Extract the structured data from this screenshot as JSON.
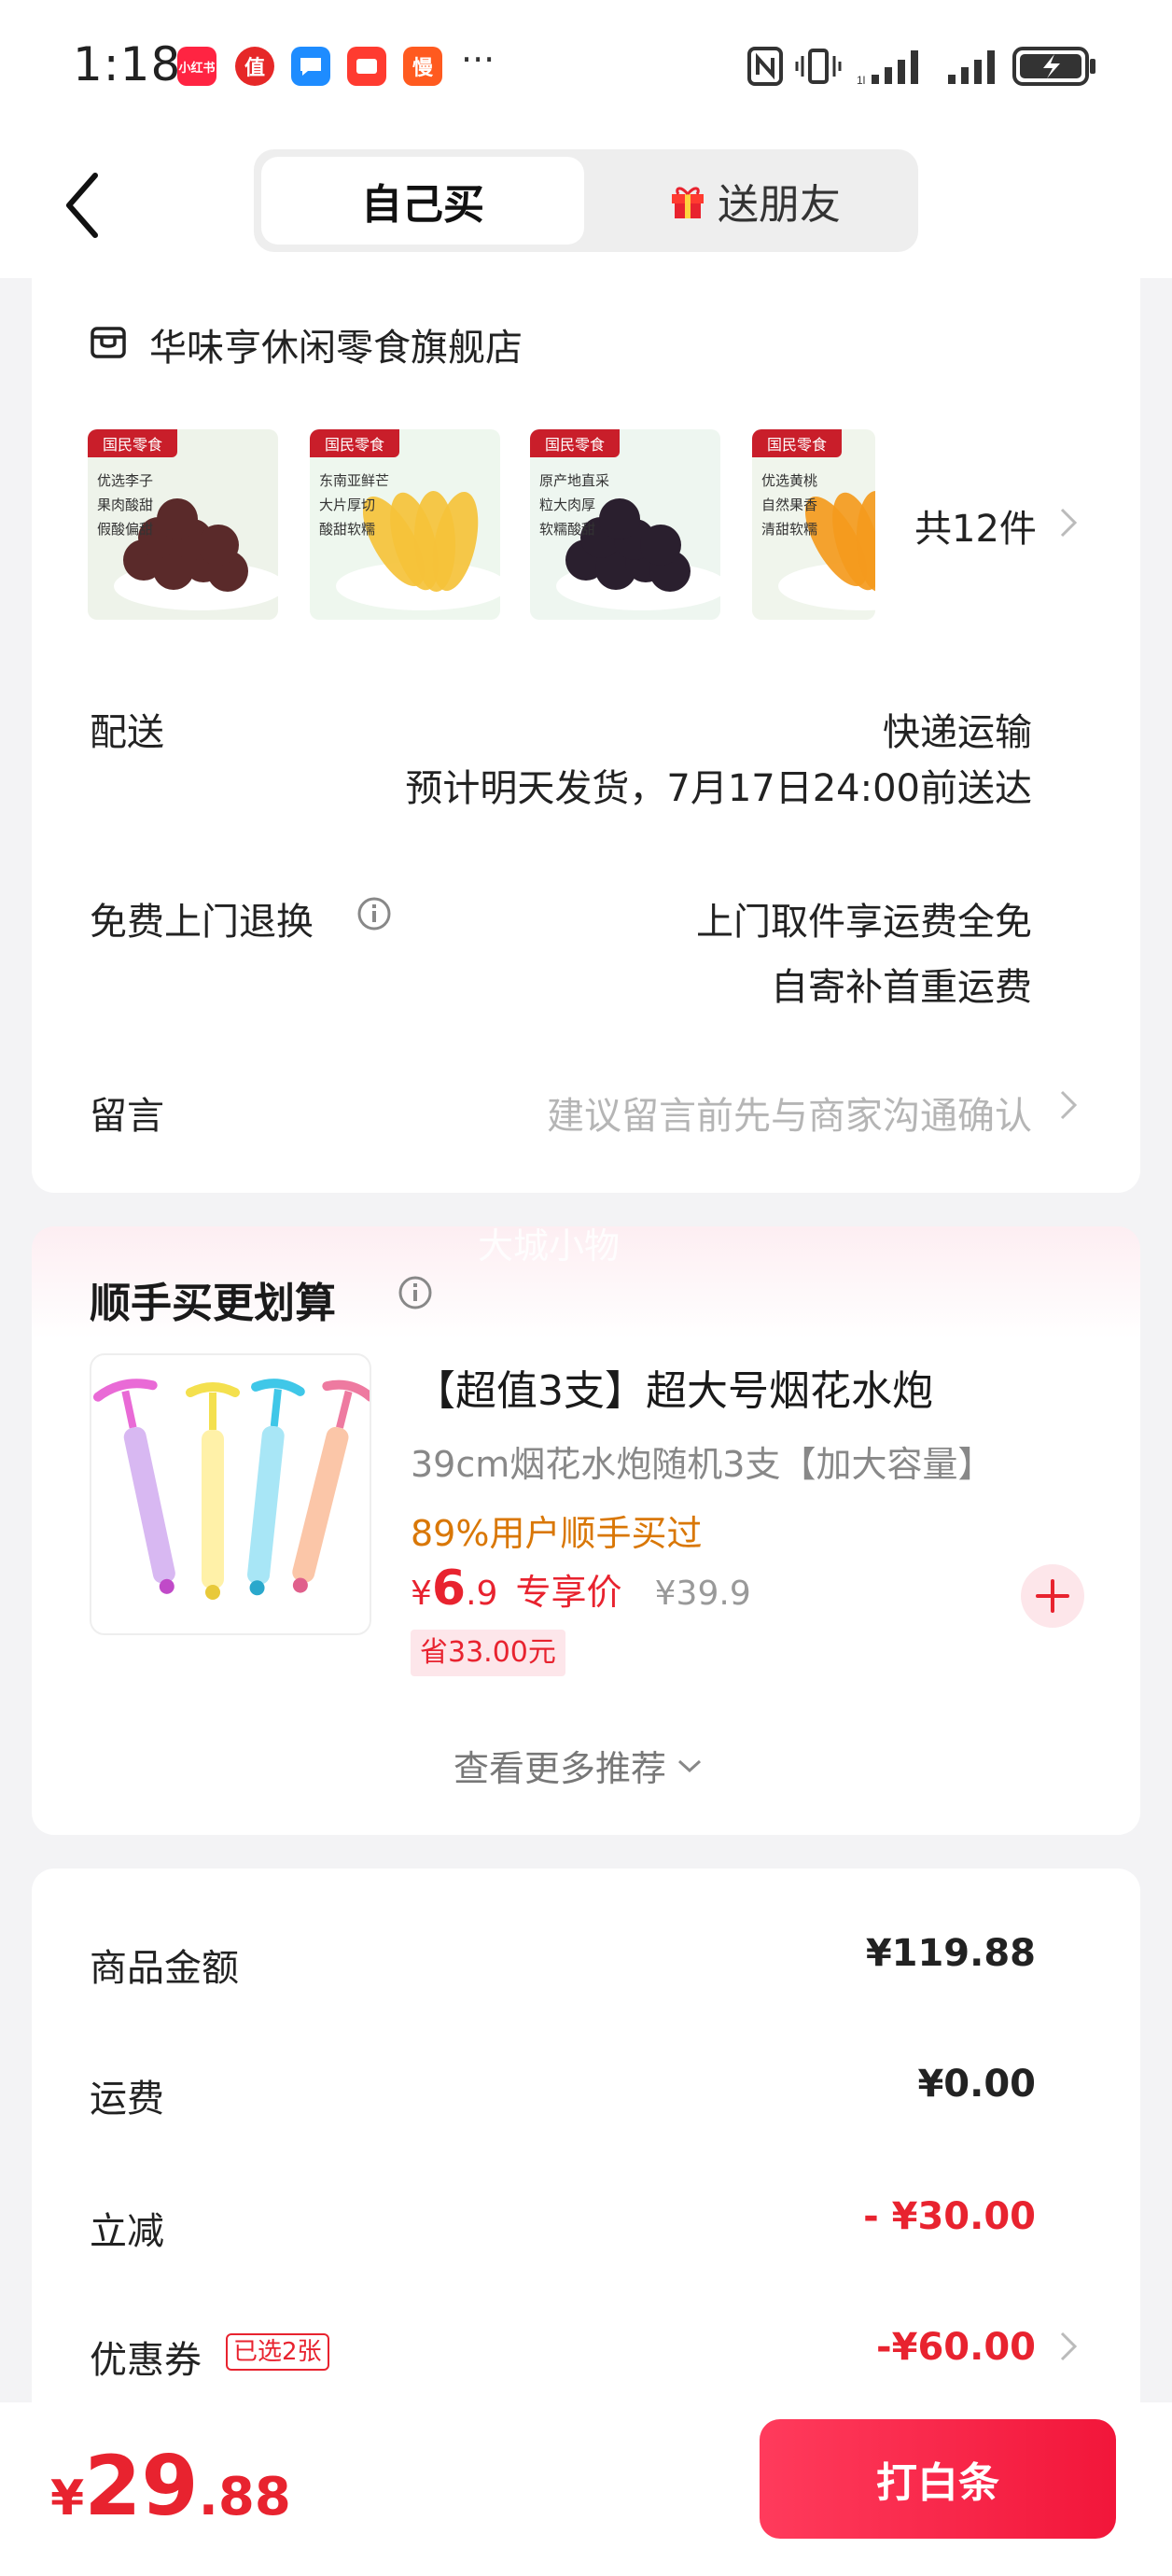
{
  "status_bar": {
    "time": "1:18",
    "app_icons": [
      {
        "name": "xiaohongshu-app-icon",
        "text": "小红书",
        "color": "#ff2442"
      },
      {
        "name": "zhide-app-icon",
        "text": "值",
        "color": "#e62828"
      },
      {
        "name": "chat-app-icon",
        "text": "",
        "color": "#1e8cff"
      },
      {
        "name": "video-app-icon",
        "text": "",
        "color": "#ff3b30"
      },
      {
        "name": "man-app-icon",
        "text": "慢",
        "color": "#ff5a1f"
      }
    ],
    "more": "···"
  },
  "header": {
    "tab_self": "自己买",
    "tab_gift": "送朋友"
  },
  "store": {
    "name": "华味亨休闲零食旗舰店",
    "items_count": "共12件",
    "products": [
      {
        "tag": "国民零食",
        "lines": [
          "优选李子",
          "果肉酸甜",
          "假酸偏甜"
        ],
        "color": "#5a2a2a",
        "bg": "#eef3ea"
      },
      {
        "tag": "国民零食",
        "lines": [
          "东南亚鲜芒",
          "大片厚切",
          "酸甜软糯"
        ],
        "color": "#f5c23a",
        "bg": "#eef7ee"
      },
      {
        "tag": "国民零食",
        "lines": [
          "原产地直采",
          "粒大肉厚",
          "软糯酸甜"
        ],
        "color": "#2a1f2e",
        "bg": "#eef6f0"
      },
      {
        "tag": "国民零食",
        "lines": [
          "优选黄桃",
          "自然果香",
          "清甜软糯"
        ],
        "color": "#f49a1d",
        "bg": "#f0f5ec"
      }
    ]
  },
  "delivery": {
    "label": "配送",
    "method": "快递运输",
    "eta": "预计明天发货，7月17日24:00前送达"
  },
  "returns": {
    "label": "免费上门退换",
    "line1": "上门取件享运费全免",
    "line2": "自寄补首重运费"
  },
  "message": {
    "label": "留言",
    "placeholder": "建议留言前先与商家沟通确认"
  },
  "addon": {
    "section_title": "顺手买更划算",
    "watermark": "大城小物",
    "product_title": "【超值3支】超大号烟花水炮",
    "product_spec": "39cm烟花水炮随机3支【加大容量】",
    "bought_ratio": "89%用户顺手买过",
    "currency": "¥",
    "price_int": "6",
    "price_dec": ".9",
    "price_label": "专享价",
    "original_price": "¥39.9",
    "saving": "省33.00元",
    "more_label": "查看更多推荐"
  },
  "summary": {
    "goods_label": "商品金额",
    "goods_value": "¥119.88",
    "shipping_label": "运费",
    "shipping_value": "¥0.00",
    "discount_label": "立减",
    "discount_value": "- ¥30.00",
    "coupon_label": "优惠券",
    "coupon_badge": "已选2张",
    "coupon_value": "-¥60.00"
  },
  "footer": {
    "currency": "¥",
    "total_int": "29",
    "total_dec": ".88",
    "pay_button": "打白条"
  },
  "colors": {
    "accent_red": "#e8232f",
    "orange": "#d97706",
    "page_bg": "#f3f3f5"
  }
}
